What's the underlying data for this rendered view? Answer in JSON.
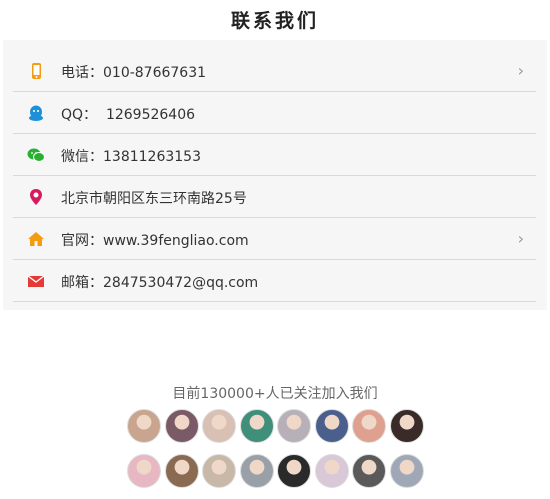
{
  "page_title": "联系我们",
  "contacts": [
    {
      "icon": "phone-icon",
      "color": "#f39c12",
      "text": "电话：010-87667631",
      "chevron": true
    },
    {
      "icon": "qq-icon",
      "color": "#1e90d8",
      "text": "QQ：  1269526406",
      "chevron": false
    },
    {
      "icon": "wechat-icon",
      "color": "#2ab030",
      "text": "微信：13811263153",
      "chevron": false
    },
    {
      "icon": "location-pin-icon",
      "color": "#d81b60",
      "text": "北京市朝阳区东三环南路25号",
      "chevron": false
    },
    {
      "icon": "home-icon",
      "color": "#f39c12",
      "text": "官网：www.39fengliao.com",
      "chevron": true
    },
    {
      "icon": "mail-icon",
      "color": "#e53935",
      "text": "邮箱：2847530472@qq.com",
      "chevron": false
    }
  ],
  "chevron_glyph": "›",
  "followers_text": "目前130000+人已关注加入我们",
  "avatar_colors": [
    [
      "#c9a48f",
      "#7a5a66",
      "#d8c0b4",
      "#3f8f7a",
      "#b8b0b8",
      "#4a5f8c",
      "#e0a090",
      "#3a2a28"
    ],
    [
      "#e7b8c4",
      "#8a6a50",
      "#c8b8a8",
      "#9aa0a8",
      "#2a2a2a",
      "#d8c8d8",
      "#5a5a5a",
      "#a0a8b8"
    ]
  ]
}
